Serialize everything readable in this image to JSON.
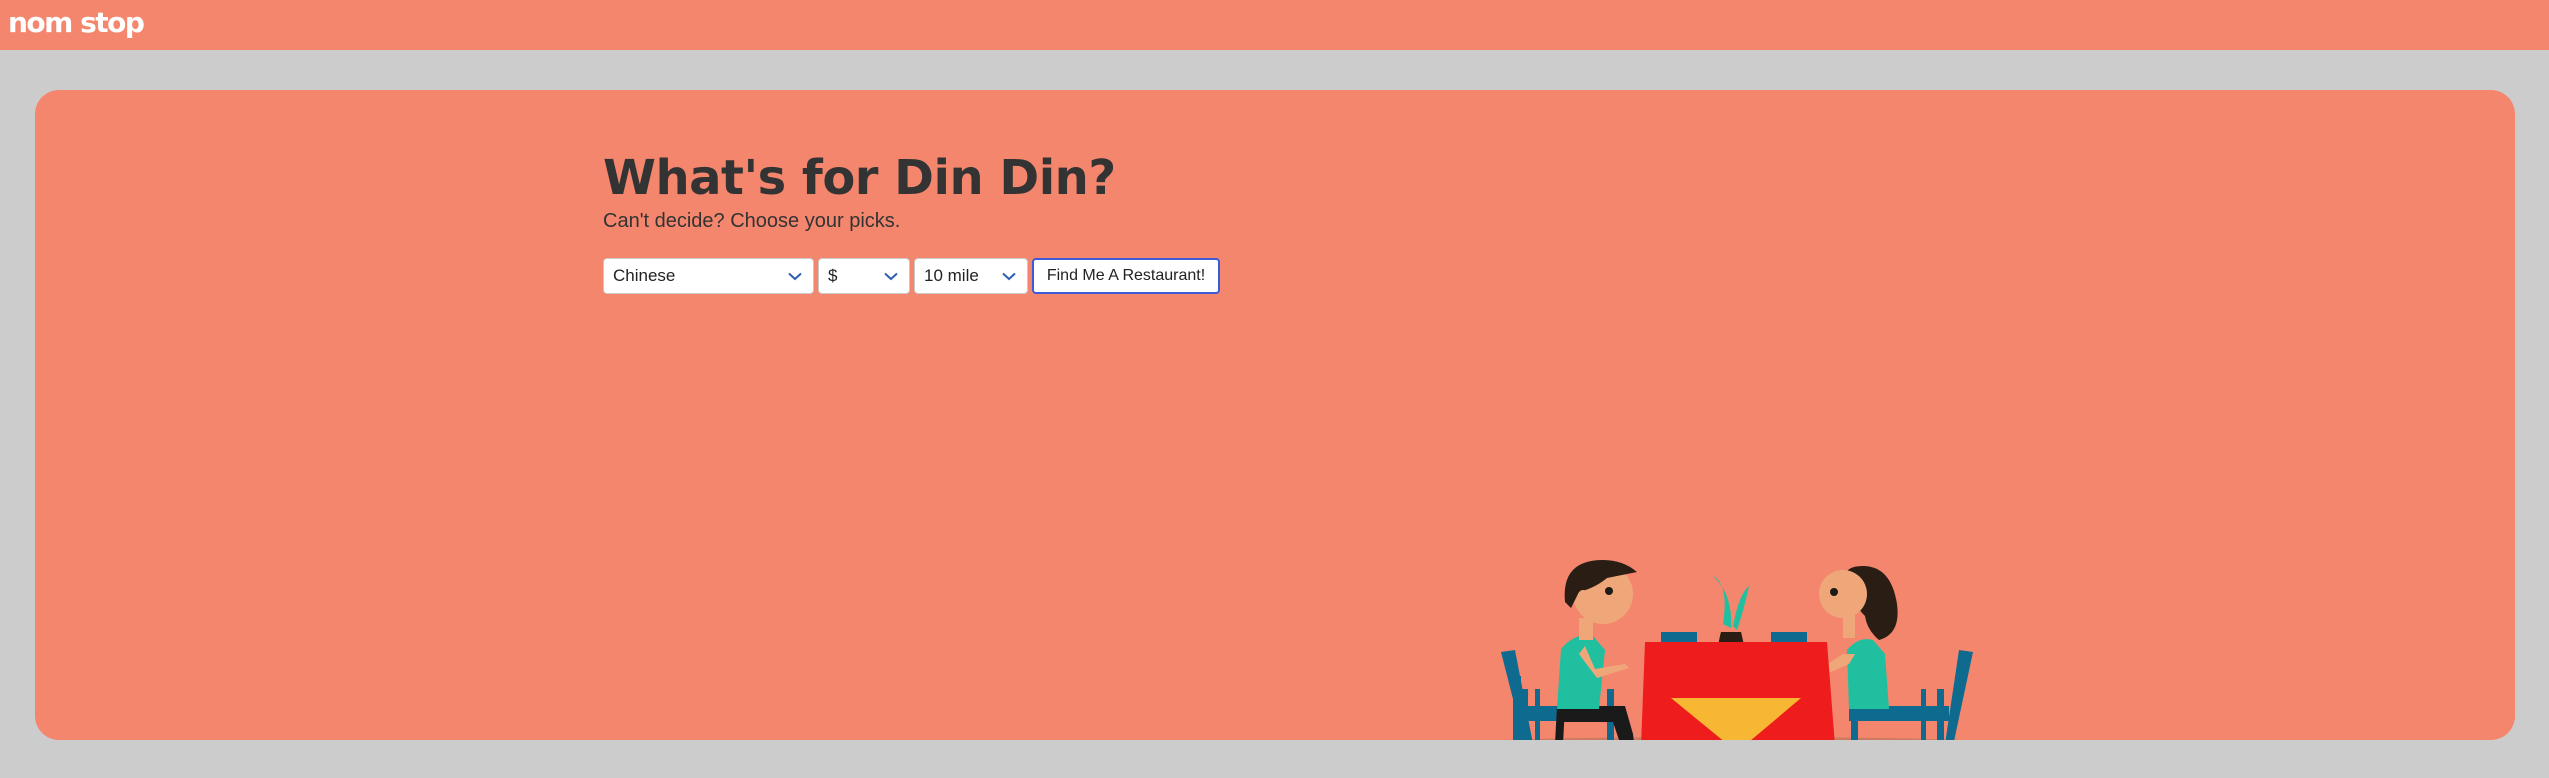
{
  "header": {
    "logo_text": "nom stop"
  },
  "hero": {
    "title": "What's for Din Din?",
    "subtitle": "Can't decide? Choose your picks.",
    "cuisine_select": {
      "value": "Chinese"
    },
    "price_select": {
      "value": "$"
    },
    "distance_select": {
      "value": "10 mile"
    },
    "find_button_label": "Find Me A Restaurant!"
  },
  "icons": {
    "dropdown": "chevron-down-icon",
    "illustration": "dinner-couple-illustration"
  },
  "colors": {
    "brand": "#f4866e",
    "background": "#cccccc",
    "text": "#333333",
    "button_border": "#3b5bdb",
    "chevron": "#2b5fb4"
  }
}
